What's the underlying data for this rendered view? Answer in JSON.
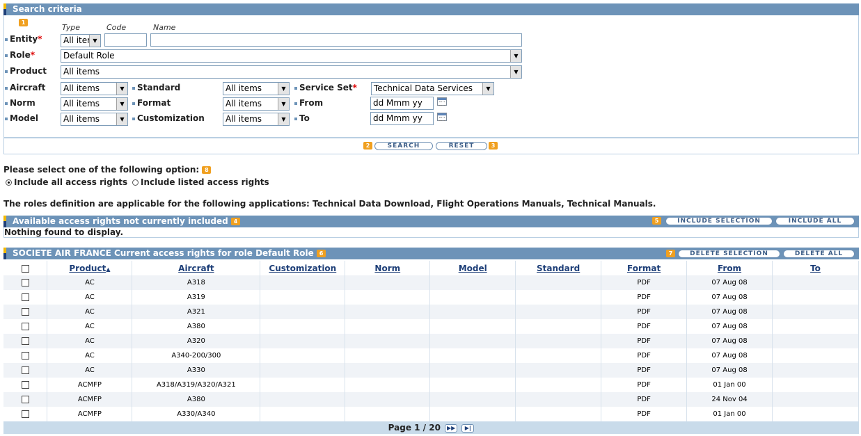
{
  "search": {
    "title": "Search criteria",
    "step1": "1",
    "col_type": "Type",
    "col_code": "Code",
    "col_name": "Name",
    "entity_label": "Entity",
    "entity_type": "All iter",
    "entity_code": "",
    "entity_name": "",
    "role_label": "Role",
    "role_value": "Default Role",
    "product_label": "Product",
    "product_value": "All items",
    "aircraft_label": "Aircraft",
    "aircraft_value": "All items",
    "norm_label": "Norm",
    "norm_value": "All items",
    "model_label": "Model",
    "model_value": "All items",
    "standard_label": "Standard",
    "standard_value": "All items",
    "format_label": "Format",
    "format_value": "All items",
    "customization_label": "Customization",
    "customization_value": "All items",
    "service_set_label": "Service Set",
    "service_set_value": "Technical Data Services",
    "from_label": "From",
    "from_value": "dd Mmm yy",
    "to_label": "To",
    "to_value": "dd Mmm yy",
    "search_label": "SEARCH",
    "reset_label": "RESET",
    "step2": "2",
    "step3": "3",
    "required_mark": "*"
  },
  "options": {
    "prompt": "Please select one of the following option:",
    "step8": "8",
    "include_all_label": "Include all access rights",
    "include_listed_label": "Include listed access rights",
    "selected": "include_all"
  },
  "info_text": "The roles definition are applicable for the following applications: Technical Data Download, Flight Operations Manuals, Technical Manuals.",
  "available": {
    "title": "Available access rights not currently included",
    "step4": "4",
    "step5": "5",
    "include_selection_label": "INCLUDE SELECTION",
    "include_all_label": "INCLUDE ALL",
    "empty_text": "Nothing found to display."
  },
  "current": {
    "title": "SOCIETE AIR FRANCE Current access rights for role Default Role",
    "step6": "6",
    "step7": "7",
    "delete_selection_label": "DELETE SELECTION",
    "delete_all_label": "DELETE ALL",
    "columns": [
      "Product",
      "Aircraft",
      "Customization",
      "Norm",
      "Model",
      "Standard",
      "Format",
      "From",
      "To"
    ],
    "sort_indicator": "▲",
    "rows": [
      {
        "product": "AC",
        "aircraft": "A318",
        "customization": "",
        "norm": "",
        "model": "",
        "standard": "",
        "format": "PDF",
        "from": "07 Aug 08",
        "to": ""
      },
      {
        "product": "AC",
        "aircraft": "A319",
        "customization": "",
        "norm": "",
        "model": "",
        "standard": "",
        "format": "PDF",
        "from": "07 Aug 08",
        "to": ""
      },
      {
        "product": "AC",
        "aircraft": "A321",
        "customization": "",
        "norm": "",
        "model": "",
        "standard": "",
        "format": "PDF",
        "from": "07 Aug 08",
        "to": ""
      },
      {
        "product": "AC",
        "aircraft": "A380",
        "customization": "",
        "norm": "",
        "model": "",
        "standard": "",
        "format": "PDF",
        "from": "07 Aug 08",
        "to": ""
      },
      {
        "product": "AC",
        "aircraft": "A320",
        "customization": "",
        "norm": "",
        "model": "",
        "standard": "",
        "format": "PDF",
        "from": "07 Aug 08",
        "to": ""
      },
      {
        "product": "AC",
        "aircraft": "A340-200/300",
        "customization": "",
        "norm": "",
        "model": "",
        "standard": "",
        "format": "PDF",
        "from": "07 Aug 08",
        "to": ""
      },
      {
        "product": "AC",
        "aircraft": "A330",
        "customization": "",
        "norm": "",
        "model": "",
        "standard": "",
        "format": "PDF",
        "from": "07 Aug 08",
        "to": ""
      },
      {
        "product": "ACMFP",
        "aircraft": "A318/A319/A320/A321",
        "customization": "",
        "norm": "",
        "model": "",
        "standard": "",
        "format": "PDF",
        "from": "01 Jan 00",
        "to": ""
      },
      {
        "product": "ACMFP",
        "aircraft": "A380",
        "customization": "",
        "norm": "",
        "model": "",
        "standard": "",
        "format": "PDF",
        "from": "24 Nov 04",
        "to": ""
      },
      {
        "product": "ACMFP",
        "aircraft": "A330/A340",
        "customization": "",
        "norm": "",
        "model": "",
        "standard": "",
        "format": "PDF",
        "from": "01 Jan 00",
        "to": ""
      }
    ],
    "pagination": "Page 1 / 20",
    "next_icon": "▶▶",
    "last_icon": "▶|"
  },
  "colors": {
    "bar": "#6d93b8",
    "link": "#1e3f78",
    "badge": "#f0a020",
    "required": "#dd0000"
  }
}
